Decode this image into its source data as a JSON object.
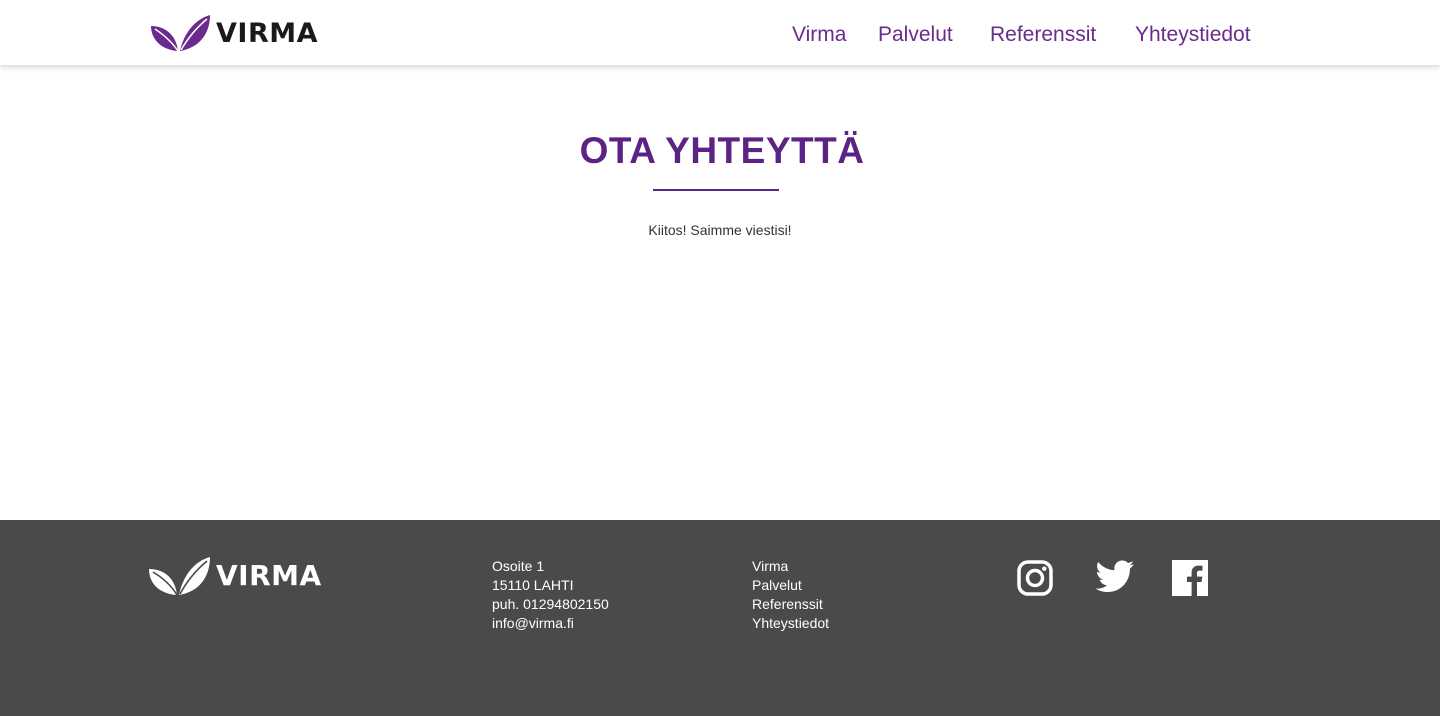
{
  "brand": {
    "name": "VIRMA",
    "primary_color": "#6a2a8e",
    "dark_text_color": "#1a1a1a",
    "footer_bg": "#4a4a4a"
  },
  "header": {
    "nav": [
      {
        "label": "Virma"
      },
      {
        "label": "Palvelut"
      },
      {
        "label": "Referenssit"
      },
      {
        "label": "Yhteystiedot"
      }
    ]
  },
  "main": {
    "title": "OTA YHTEYTTÄ",
    "message": "Kiitos! Saimme viestisi!"
  },
  "footer": {
    "address": {
      "street": "Osoite 1",
      "postal": "15110 LAHTI",
      "phone": "puh. 01294802150",
      "email": "info@virma.fi"
    },
    "nav": [
      {
        "label": "Virma"
      },
      {
        "label": "Palvelut"
      },
      {
        "label": "Referenssit"
      },
      {
        "label": "Yhteystiedot"
      }
    ],
    "social": [
      {
        "icon": "instagram-icon"
      },
      {
        "icon": "twitter-icon"
      },
      {
        "icon": "facebook-icon"
      }
    ]
  }
}
